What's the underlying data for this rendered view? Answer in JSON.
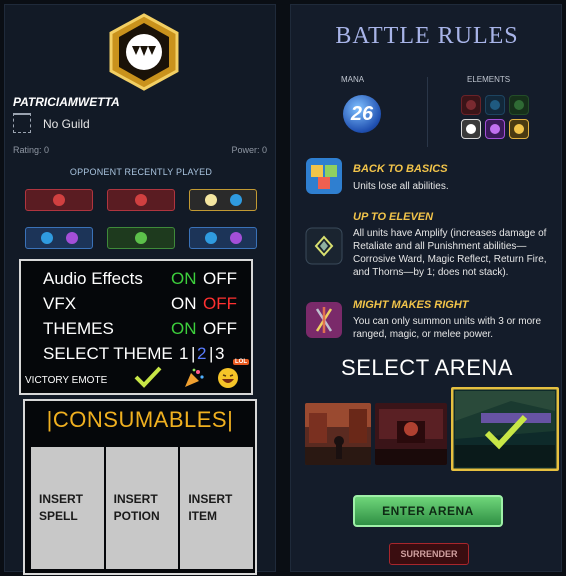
{
  "player": {
    "name": "PATRICIAMWETTA",
    "guild": "No Guild",
    "rating": "Rating: 0",
    "power": "Power: 0"
  },
  "opponent": {
    "title": "OPPONENT RECENTLY PLAYED"
  },
  "settings": {
    "audio_label": "Audio Effects",
    "vfx_label": "VFX",
    "themes_label": "THEMES",
    "select_theme_label": "SELECT THEME",
    "on": "ON",
    "off": "OFF",
    "theme_1": "1",
    "theme_2": "2",
    "theme_3": "3",
    "victory_emote": "VICTORY EMOTE",
    "lol": "LOL"
  },
  "consumables": {
    "title": "|CONSUMABLES|",
    "slots": [
      "INSERT SPELL",
      "INSERT POTION",
      "INSERT ITEM"
    ]
  },
  "battle": {
    "title": "BATTLE RULES",
    "mana_label": "MANA",
    "mana_value": "26",
    "elements_label": "ELEMENTS",
    "rules": [
      {
        "name": "BACK TO BASICS",
        "desc": "Units lose all abilities."
      },
      {
        "name": "UP TO ELEVEN",
        "desc": "All units have Amplify (increases damage of Retaliate and all Punishment abilities—Corrosive Ward, Magic Reflect, Return Fire, and Thorns—by 1; does not stack)."
      },
      {
        "name": "MIGHT MAKES RIGHT",
        "desc": "You can only summon units with 3 or more ranged, magic, or melee power."
      }
    ],
    "select_arena": "SELECT ARENA",
    "enter_arena": "ENTER ARENA",
    "surrender": "SURRENDER"
  },
  "colors": {
    "accent_gold": "#f0b020",
    "on_green": "#3ccf3c",
    "off_red": "#ff3030",
    "rule_name": "#f2c44a"
  }
}
